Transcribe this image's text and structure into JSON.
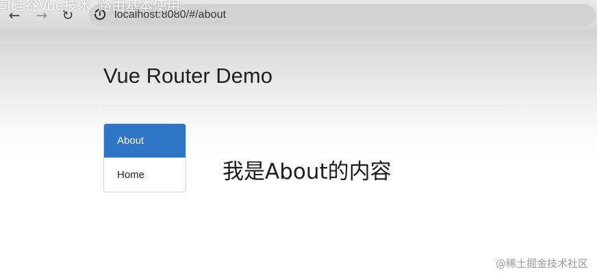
{
  "overlay": {
    "title": "司硅谷Vue技术_路由基本使用"
  },
  "browser": {
    "back_icon": "arrow-left-icon",
    "forward_icon": "arrow-right-icon",
    "reload_icon": "reload-icon",
    "info_icon": "info-icon",
    "url": "localhost:8080/#/about"
  },
  "page": {
    "title": "Vue Router Demo",
    "nav": [
      {
        "label": "About",
        "active": true
      },
      {
        "label": "Home",
        "active": false
      }
    ],
    "content": "我是About的内容"
  },
  "watermark": "@稀土掘金技术社区",
  "colors": {
    "active_nav": "#2f75c5",
    "active_nav_text": "#ffffff"
  }
}
